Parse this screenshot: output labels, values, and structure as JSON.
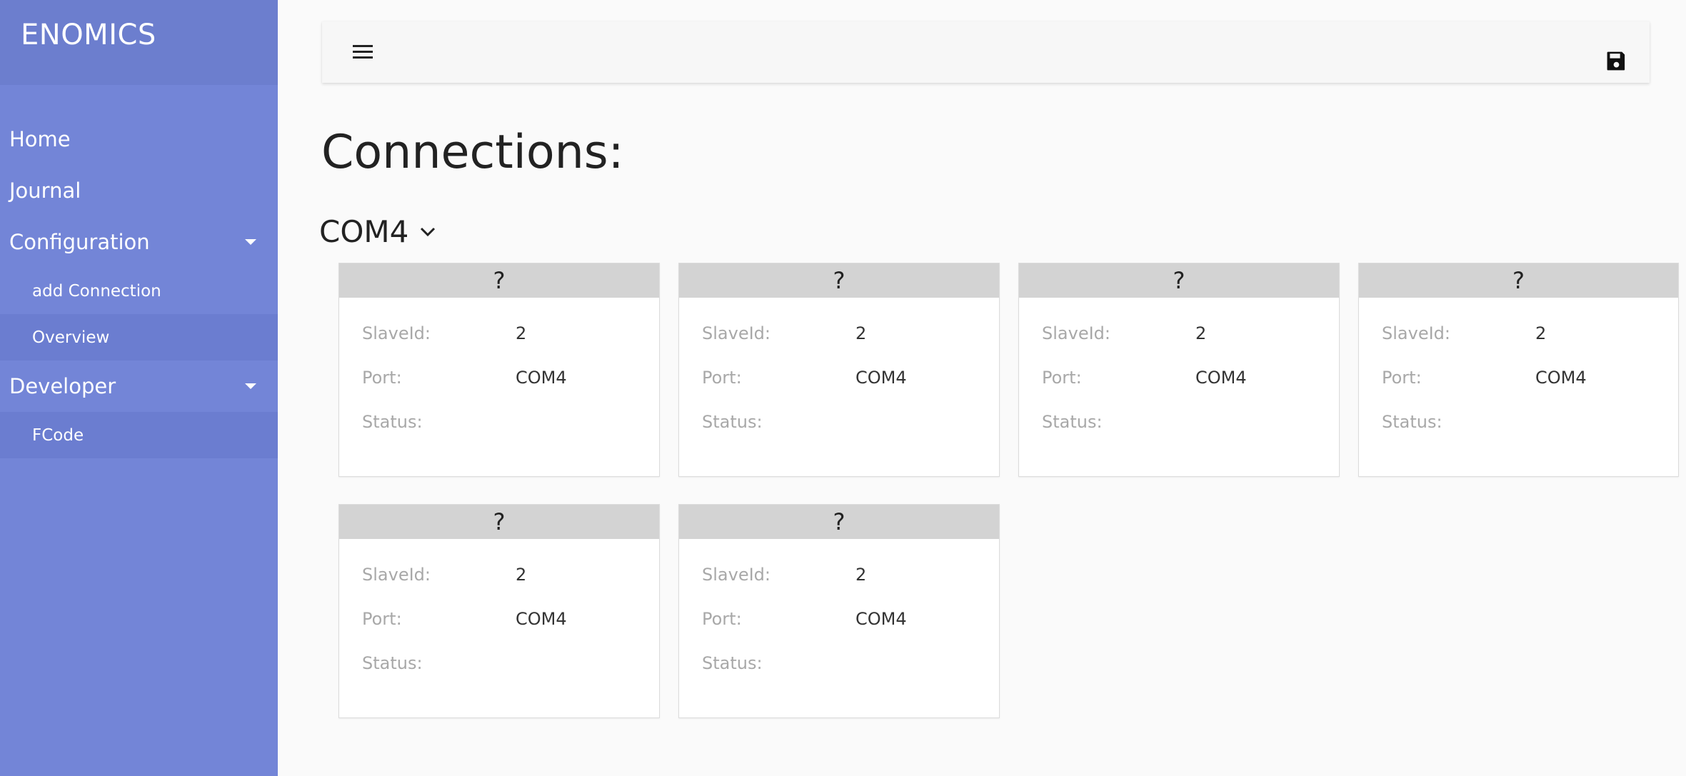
{
  "brand": "ENOMICS",
  "nav": {
    "home": "Home",
    "journal": "Journal",
    "configuration": "Configuration",
    "add_connection": "add Connection",
    "overview": "Overview",
    "developer": "Developer",
    "fcode": "FCode"
  },
  "page_title": "Connections:",
  "group": {
    "title": "COM4"
  },
  "labels": {
    "slave_id": "SlaveId:",
    "port": "Port:",
    "status": "Status:"
  },
  "cards": [
    {
      "title": "?",
      "slave_id": "2",
      "port": "COM4",
      "status": ""
    },
    {
      "title": "?",
      "slave_id": "2",
      "port": "COM4",
      "status": ""
    },
    {
      "title": "?",
      "slave_id": "2",
      "port": "COM4",
      "status": ""
    },
    {
      "title": "?",
      "slave_id": "2",
      "port": "COM4",
      "status": ""
    },
    {
      "title": "?",
      "slave_id": "2",
      "port": "COM4",
      "status": ""
    },
    {
      "title": "?",
      "slave_id": "2",
      "port": "COM4",
      "status": ""
    }
  ],
  "colors": {
    "sidebar": "#7385d7",
    "sidebar_brand": "#6c7ece",
    "card_header": "#d3d3d3"
  },
  "icons": {
    "menu": "hamburger-menu-icon",
    "save": "floppy-disk-icon",
    "expand": "chevron-down-icon",
    "submenu": "caret-down-icon"
  }
}
